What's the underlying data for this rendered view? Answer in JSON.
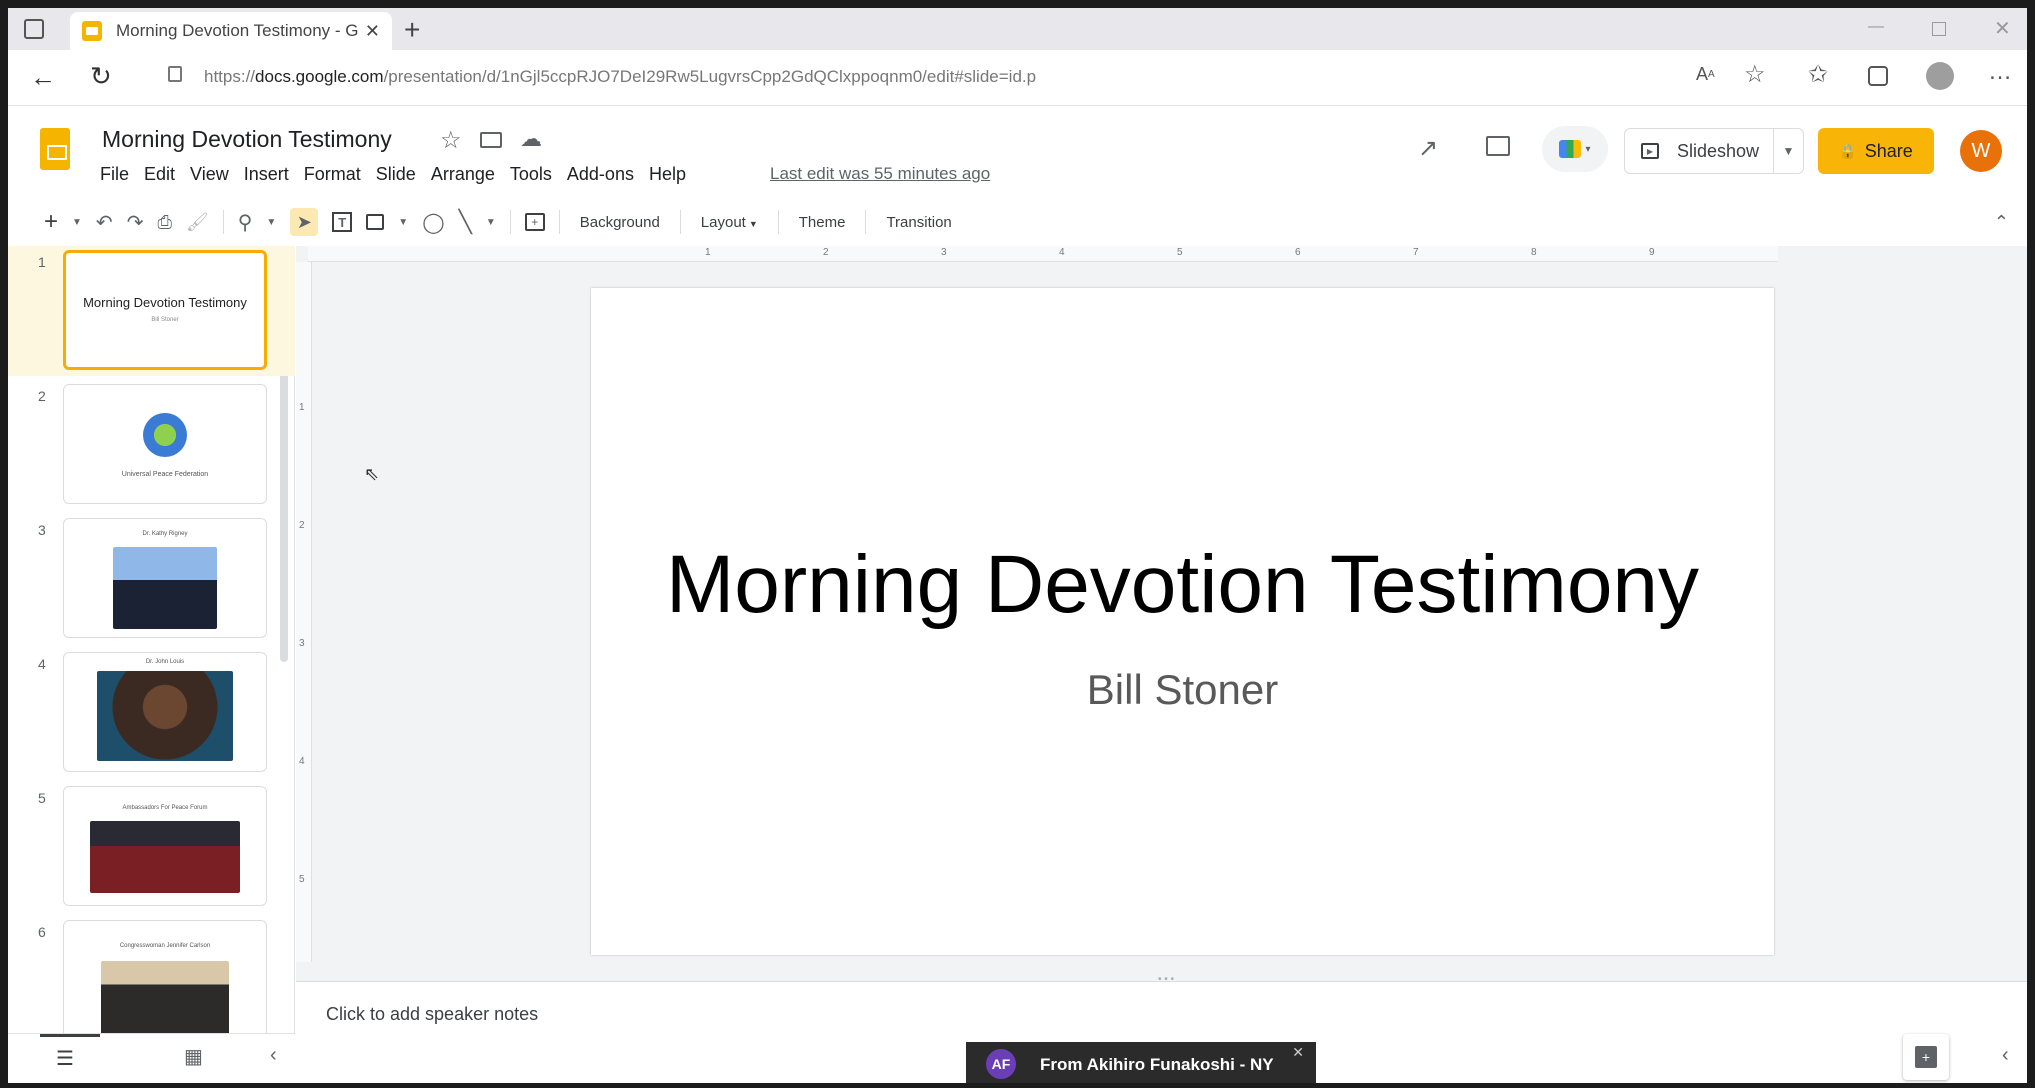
{
  "browser": {
    "tab_title": "Morning Devotion Testimony - G",
    "url_prefix": "https://",
    "url_domain": "docs.google.com",
    "url_path": "/presentation/d/1nGjl5ccpRJO7DeI29Rw5LugvrsCpp2GdQClxppoqnm0/edit#slide=id.p"
  },
  "doc": {
    "title": "Morning Devotion Testimony",
    "menus": [
      "File",
      "Edit",
      "View",
      "Insert",
      "Format",
      "Slide",
      "Arrange",
      "Tools",
      "Add-ons",
      "Help"
    ],
    "last_edit": "Last edit was 55 minutes ago",
    "slideshow_label": "Slideshow",
    "share_label": "Share",
    "avatar_letter": "W"
  },
  "toolbar": {
    "background_label": "Background",
    "layout_label": "Layout",
    "theme_label": "Theme",
    "transition_label": "Transition"
  },
  "filmstrip": {
    "slides": [
      {
        "num": "1",
        "title": "Morning Devotion Testimony",
        "subtitle": "Bill Stoner"
      },
      {
        "num": "2",
        "title": "Universal Peace Federation"
      },
      {
        "num": "3",
        "title": "Dr. Kathy Rigney"
      },
      {
        "num": "4",
        "title": "Dr. John Louis"
      },
      {
        "num": "5",
        "title": "Ambassadors For Peace Forum"
      },
      {
        "num": "6",
        "title": "Congresswoman Jennifer Carlson"
      }
    ]
  },
  "rulers": {
    "h": [
      "1",
      "2",
      "3",
      "4",
      "5",
      "6",
      "7",
      "8",
      "9"
    ],
    "v": [
      "1",
      "2",
      "3",
      "4",
      "5"
    ]
  },
  "slide": {
    "title": "Morning Devotion Testimony",
    "subtitle": "Bill Stoner"
  },
  "notes": {
    "placeholder": "Click to add speaker notes"
  },
  "toast": {
    "initials": "AF",
    "text": "From Akihiro Funakoshi - NY"
  },
  "colors": {
    "accent": "#f9b408",
    "selected_border": "#f9ab00",
    "avatar": "#e8710a"
  }
}
